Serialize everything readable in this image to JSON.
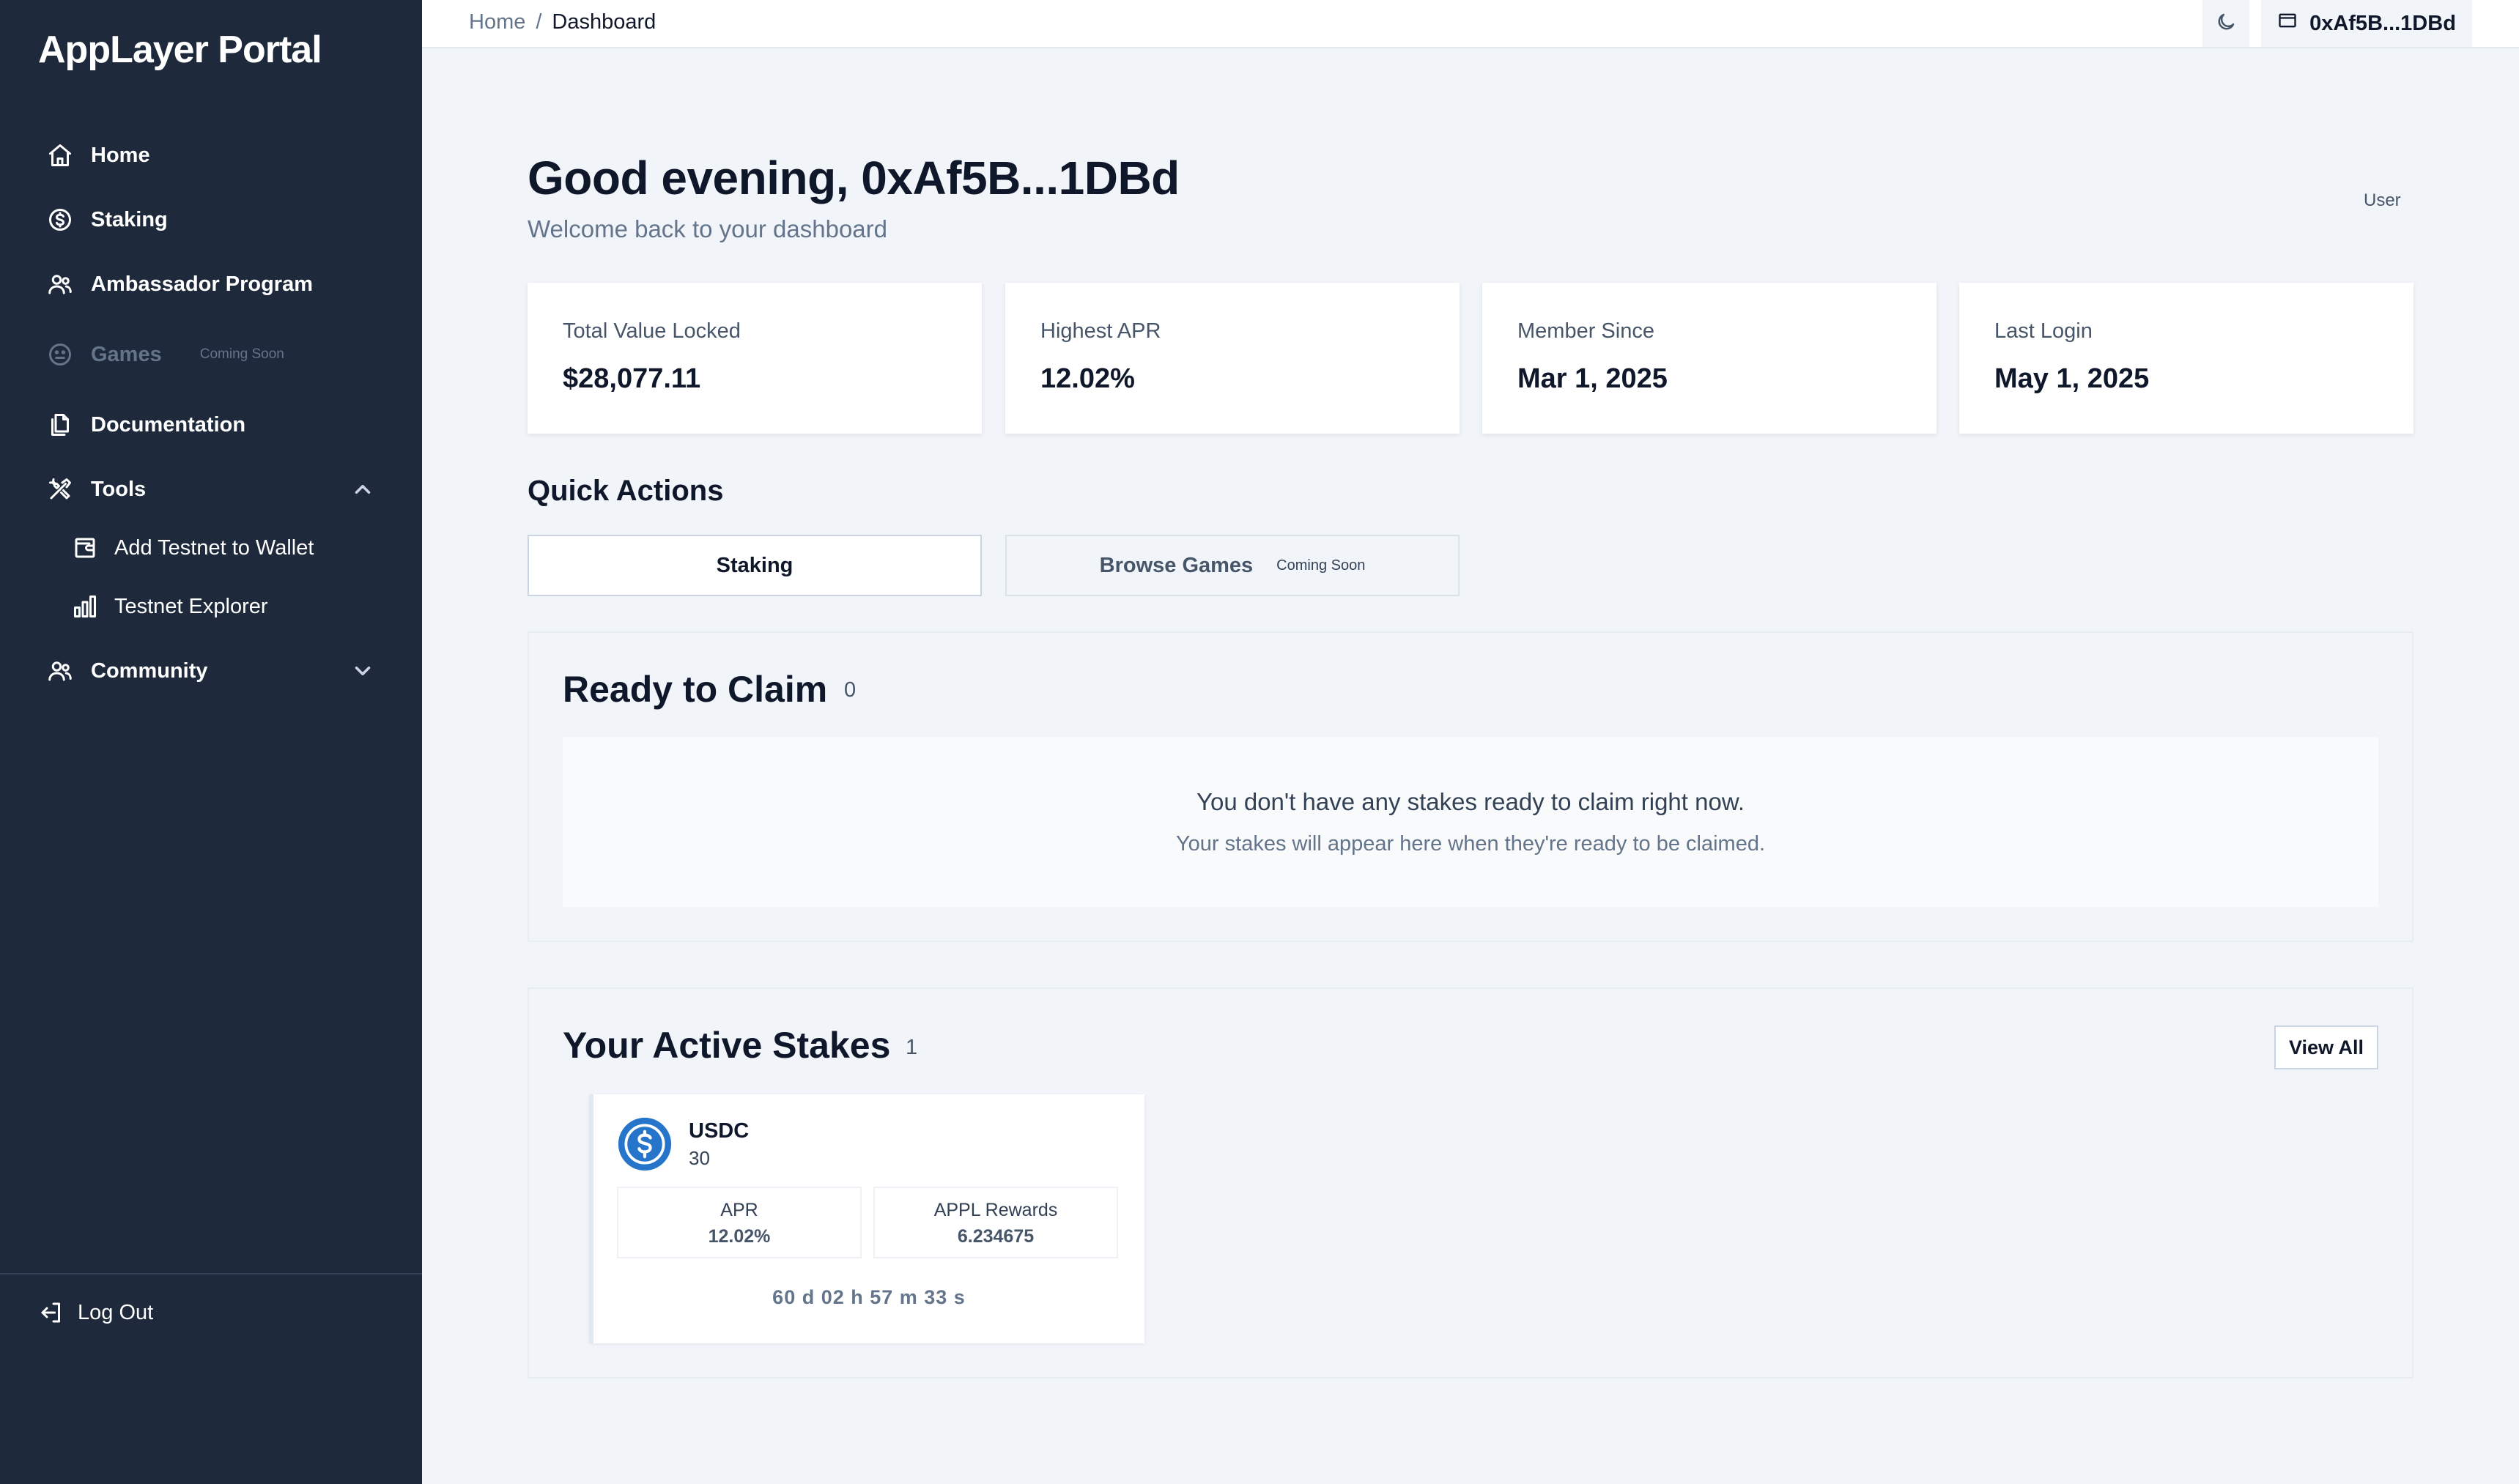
{
  "app": {
    "name": "AppLayer Portal"
  },
  "sidebar": {
    "items": [
      {
        "label": "Home",
        "icon": "home-icon"
      },
      {
        "label": "Staking",
        "icon": "dollar-circle-icon"
      },
      {
        "label": "Ambassador Program",
        "icon": "users-icon"
      },
      {
        "label": "Games",
        "icon": "smiley-icon",
        "badge": "Coming Soon"
      },
      {
        "label": "Documentation",
        "icon": "documents-icon"
      },
      {
        "label": "Tools",
        "icon": "tools-icon"
      },
      {
        "label": "Community",
        "icon": "community-icon"
      }
    ],
    "tools_sub": [
      {
        "label": "Add Testnet to Wallet",
        "icon": "wallet-icon"
      },
      {
        "label": "Testnet Explorer",
        "icon": "bar-chart-icon"
      }
    ],
    "logout": "Log Out"
  },
  "topbar": {
    "breadcrumb": [
      "Home",
      "Dashboard"
    ],
    "breadcrumb_sep": "/",
    "wallet": "0xAf5B...1DBd"
  },
  "main": {
    "greeting": "Good evening, 0xAf5B...1DBd",
    "subgreeting": "Welcome back to your dashboard",
    "role": "User",
    "stats": [
      {
        "label": "Total Value Locked",
        "value": "$28,077.11"
      },
      {
        "label": "Highest APR",
        "value": "12.02%"
      },
      {
        "label": "Member Since",
        "value": "Mar 1, 2025"
      },
      {
        "label": "Last Login",
        "value": "May 1, 2025"
      }
    ],
    "quick_actions": {
      "title": "Quick Actions",
      "staking": "Staking",
      "browse_games": "Browse Games",
      "coming_soon": "Coming Soon"
    },
    "ready_to_claim": {
      "title": "Ready to Claim",
      "count": "0",
      "empty_main": "You don't have any stakes ready to claim right now.",
      "empty_sub": "Your stakes will appear here when they're ready to be claimed."
    },
    "active_stakes": {
      "title": "Your Active Stakes",
      "count": "1",
      "view_all": "View All",
      "stakes": [
        {
          "token": "USDC",
          "amount": "30",
          "apr_label": "APR",
          "apr": "12.02%",
          "rewards_label": "APPL Rewards",
          "rewards": "6.234675",
          "countdown": "60 d  02 h  57 m  33 s"
        }
      ]
    }
  },
  "colors": {
    "sidebar": "#1e293b",
    "background": "#f1f4f9",
    "usdc": "#2775ca"
  }
}
